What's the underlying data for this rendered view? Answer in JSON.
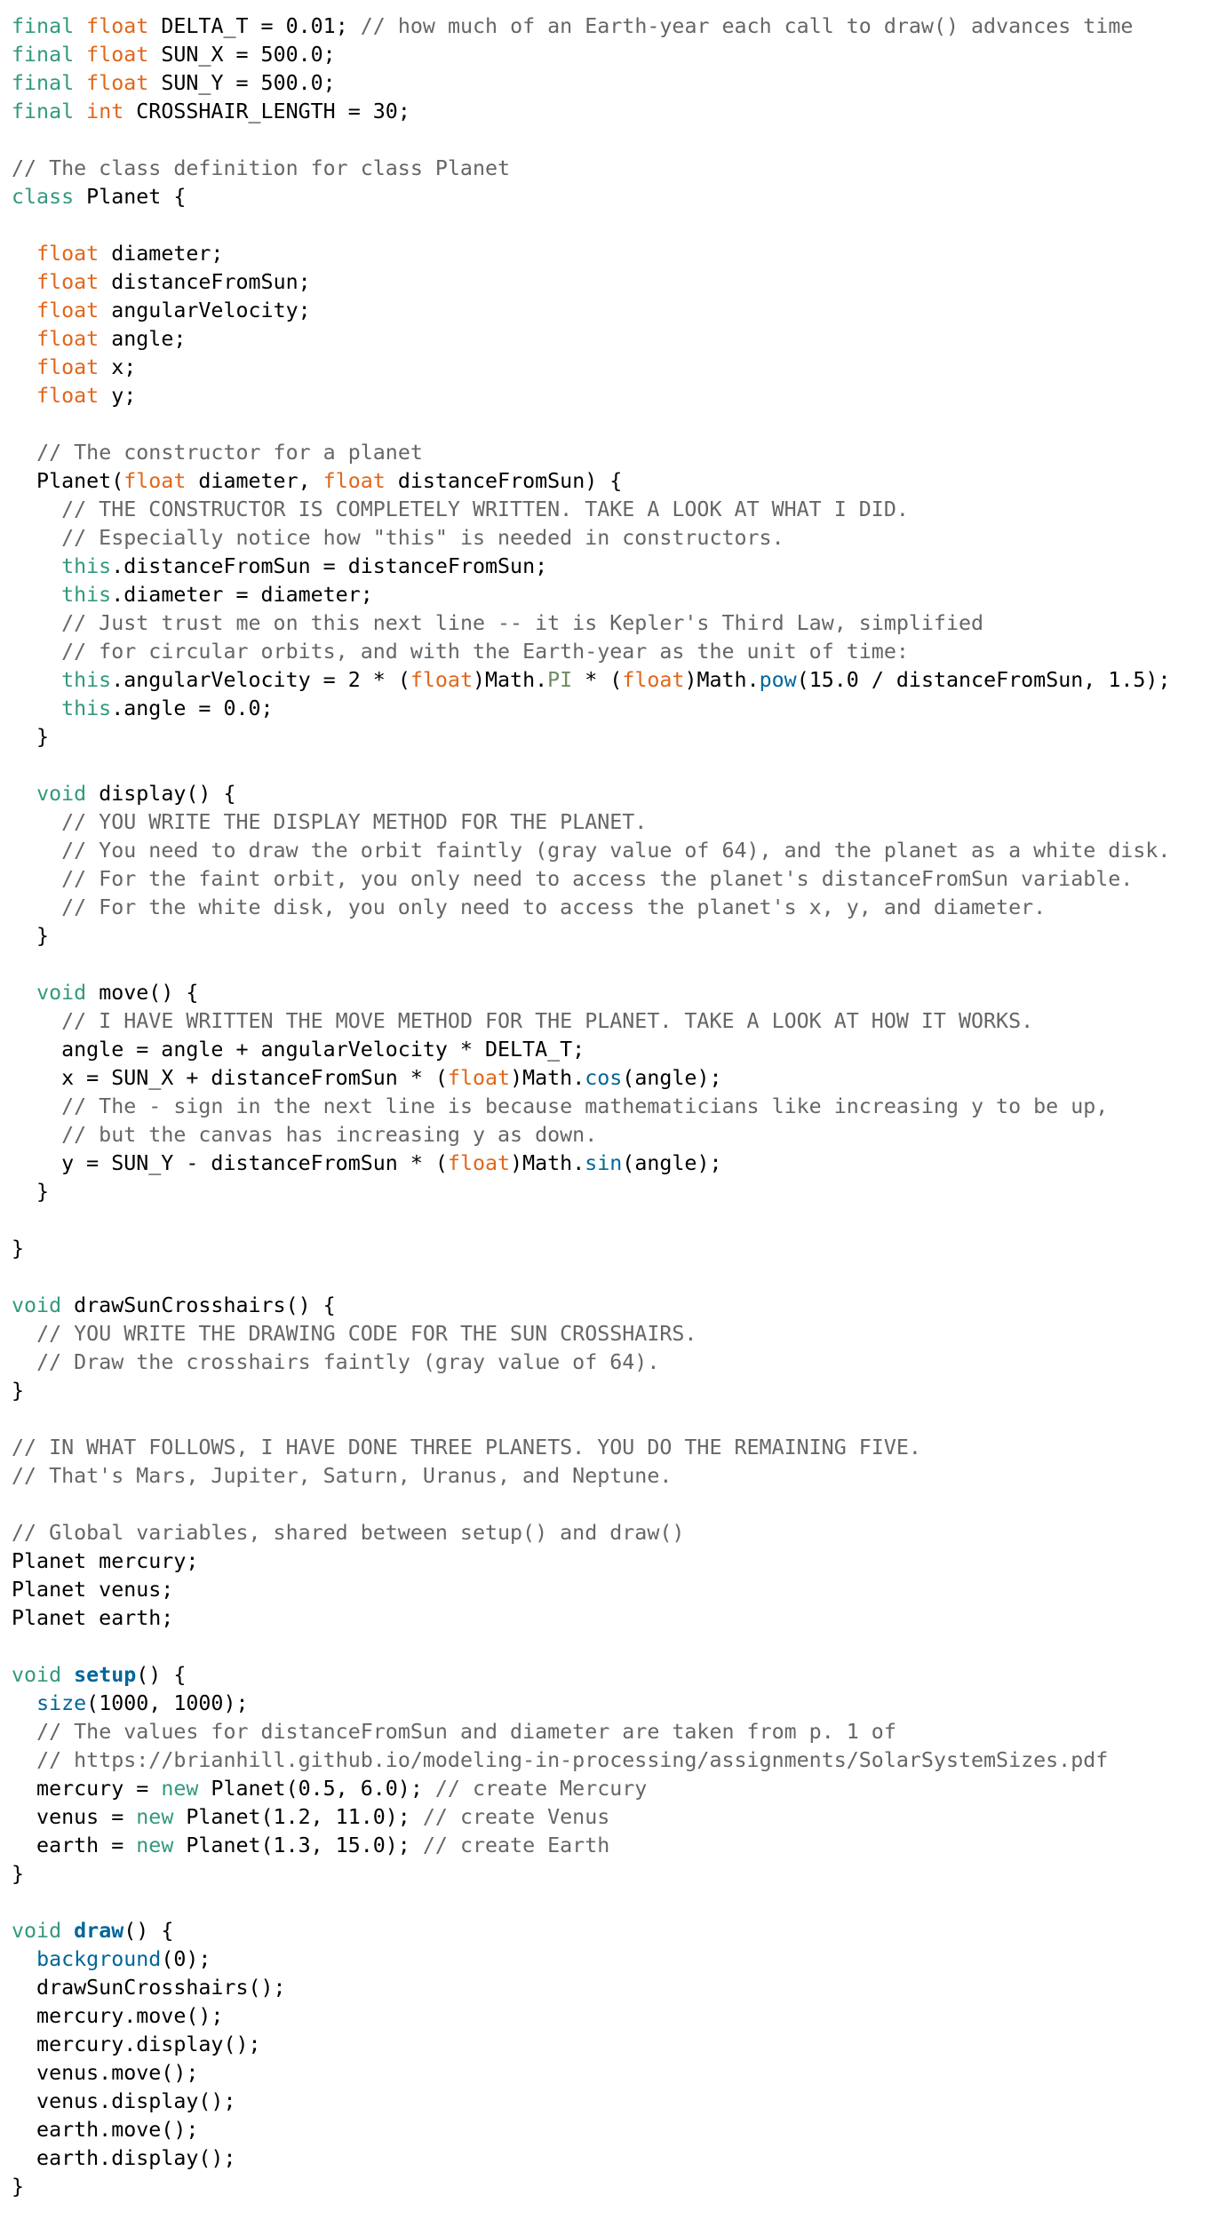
{
  "document": {
    "language": "Processing",
    "colors": {
      "plain": "#000000",
      "kw1": "#33997e",
      "type": "#e2661a",
      "comment": "#666666",
      "fn": "#006699",
      "fnbold": "#006699",
      "const": "#718a62"
    },
    "lines": [
      [
        [
          "kw1",
          "final"
        ],
        [
          "plain",
          " "
        ],
        [
          "type",
          "float"
        ],
        [
          "plain",
          " DELTA_T = 0.01; "
        ],
        [
          "comment",
          "// how much of an Earth-year each call to draw() advances time"
        ]
      ],
      [
        [
          "kw1",
          "final"
        ],
        [
          "plain",
          " "
        ],
        [
          "type",
          "float"
        ],
        [
          "plain",
          " SUN_X = 500.0;"
        ]
      ],
      [
        [
          "kw1",
          "final"
        ],
        [
          "plain",
          " "
        ],
        [
          "type",
          "float"
        ],
        [
          "plain",
          " SUN_Y = 500.0;"
        ]
      ],
      [
        [
          "kw1",
          "final"
        ],
        [
          "plain",
          " "
        ],
        [
          "type",
          "int"
        ],
        [
          "plain",
          " CROSSHAIR_LENGTH = 30;"
        ]
      ],
      [],
      [
        [
          "comment",
          "// The class definition for class Planet"
        ]
      ],
      [
        [
          "kw1",
          "class"
        ],
        [
          "plain",
          " Planet {"
        ]
      ],
      [],
      [
        [
          "plain",
          "  "
        ],
        [
          "type",
          "float"
        ],
        [
          "plain",
          " diameter;"
        ]
      ],
      [
        [
          "plain",
          "  "
        ],
        [
          "type",
          "float"
        ],
        [
          "plain",
          " distanceFromSun;"
        ]
      ],
      [
        [
          "plain",
          "  "
        ],
        [
          "type",
          "float"
        ],
        [
          "plain",
          " angularVelocity;"
        ]
      ],
      [
        [
          "plain",
          "  "
        ],
        [
          "type",
          "float"
        ],
        [
          "plain",
          " angle;"
        ]
      ],
      [
        [
          "plain",
          "  "
        ],
        [
          "type",
          "float"
        ],
        [
          "plain",
          " x;"
        ]
      ],
      [
        [
          "plain",
          "  "
        ],
        [
          "type",
          "float"
        ],
        [
          "plain",
          " y;"
        ]
      ],
      [],
      [
        [
          "plain",
          "  "
        ],
        [
          "comment",
          "// The constructor for a planet"
        ]
      ],
      [
        [
          "plain",
          "  Planet("
        ],
        [
          "type",
          "float"
        ],
        [
          "plain",
          " diameter, "
        ],
        [
          "type",
          "float"
        ],
        [
          "plain",
          " distanceFromSun) {"
        ]
      ],
      [
        [
          "plain",
          "    "
        ],
        [
          "comment",
          "// THE CONSTRUCTOR IS COMPLETELY WRITTEN. TAKE A LOOK AT WHAT I DID."
        ]
      ],
      [
        [
          "plain",
          "    "
        ],
        [
          "comment",
          "// Especially notice how \"this\" is needed in constructors."
        ]
      ],
      [
        [
          "plain",
          "    "
        ],
        [
          "kw1",
          "this"
        ],
        [
          "plain",
          ".distanceFromSun = distanceFromSun;"
        ]
      ],
      [
        [
          "plain",
          "    "
        ],
        [
          "kw1",
          "this"
        ],
        [
          "plain",
          ".diameter = diameter;"
        ]
      ],
      [
        [
          "plain",
          "    "
        ],
        [
          "comment",
          "// Just trust me on this next line -- it is Kepler's Third Law, simplified"
        ]
      ],
      [
        [
          "plain",
          "    "
        ],
        [
          "comment",
          "// for circular orbits, and with the Earth-year as the unit of time:"
        ]
      ],
      [
        [
          "plain",
          "    "
        ],
        [
          "kw1",
          "this"
        ],
        [
          "plain",
          ".angularVelocity = 2 * ("
        ],
        [
          "type",
          "float"
        ],
        [
          "plain",
          ")Math."
        ],
        [
          "const",
          "PI"
        ],
        [
          "plain",
          " * ("
        ],
        [
          "type",
          "float"
        ],
        [
          "plain",
          ")Math."
        ],
        [
          "fn",
          "pow"
        ],
        [
          "plain",
          "(15.0 / distanceFromSun, 1.5);"
        ]
      ],
      [
        [
          "plain",
          "    "
        ],
        [
          "kw1",
          "this"
        ],
        [
          "plain",
          ".angle = 0.0;"
        ]
      ],
      [
        [
          "plain",
          "  }"
        ]
      ],
      [],
      [
        [
          "plain",
          "  "
        ],
        [
          "kw1",
          "void"
        ],
        [
          "plain",
          " display() {"
        ]
      ],
      [
        [
          "plain",
          "    "
        ],
        [
          "comment",
          "// YOU WRITE THE DISPLAY METHOD FOR THE PLANET."
        ]
      ],
      [
        [
          "plain",
          "    "
        ],
        [
          "comment",
          "// You need to draw the orbit faintly (gray value of 64), and the planet as a white disk."
        ]
      ],
      [
        [
          "plain",
          "    "
        ],
        [
          "comment",
          "// For the faint orbit, you only need to access the planet's distanceFromSun variable."
        ]
      ],
      [
        [
          "plain",
          "    "
        ],
        [
          "comment",
          "// For the white disk, you only need to access the planet's x, y, and diameter."
        ]
      ],
      [
        [
          "plain",
          "  }"
        ]
      ],
      [],
      [
        [
          "plain",
          "  "
        ],
        [
          "kw1",
          "void"
        ],
        [
          "plain",
          " move() {"
        ]
      ],
      [
        [
          "plain",
          "    "
        ],
        [
          "comment",
          "// I HAVE WRITTEN THE MOVE METHOD FOR THE PLANET. TAKE A LOOK AT HOW IT WORKS."
        ]
      ],
      [
        [
          "plain",
          "    angle = angle + angularVelocity * DELTA_T;"
        ]
      ],
      [
        [
          "plain",
          "    x = SUN_X + distanceFromSun * ("
        ],
        [
          "type",
          "float"
        ],
        [
          "plain",
          ")Math."
        ],
        [
          "fn",
          "cos"
        ],
        [
          "plain",
          "(angle);"
        ]
      ],
      [
        [
          "plain",
          "    "
        ],
        [
          "comment",
          "// The - sign in the next line is because mathematicians like increasing y to be up,"
        ]
      ],
      [
        [
          "plain",
          "    "
        ],
        [
          "comment",
          "// but the canvas has increasing y as down."
        ]
      ],
      [
        [
          "plain",
          "    y = SUN_Y - distanceFromSun * ("
        ],
        [
          "type",
          "float"
        ],
        [
          "plain",
          ")Math."
        ],
        [
          "fn",
          "sin"
        ],
        [
          "plain",
          "(angle);"
        ]
      ],
      [
        [
          "plain",
          "  }"
        ]
      ],
      [],
      [
        [
          "plain",
          "}"
        ]
      ],
      [],
      [
        [
          "kw1",
          "void"
        ],
        [
          "plain",
          " drawSunCrosshairs() {"
        ]
      ],
      [
        [
          "plain",
          "  "
        ],
        [
          "comment",
          "// YOU WRITE THE DRAWING CODE FOR THE SUN CROSSHAIRS."
        ]
      ],
      [
        [
          "plain",
          "  "
        ],
        [
          "comment",
          "// Draw the crosshairs faintly (gray value of 64)."
        ]
      ],
      [
        [
          "plain",
          "}"
        ]
      ],
      [],
      [
        [
          "comment",
          "// IN WHAT FOLLOWS, I HAVE DONE THREE PLANETS. YOU DO THE REMAINING FIVE."
        ]
      ],
      [
        [
          "comment",
          "// That's Mars, Jupiter, Saturn, Uranus, and Neptune."
        ]
      ],
      [],
      [
        [
          "comment",
          "// Global variables, shared between setup() and draw()"
        ]
      ],
      [
        [
          "plain",
          "Planet mercury;"
        ]
      ],
      [
        [
          "plain",
          "Planet venus;"
        ]
      ],
      [
        [
          "plain",
          "Planet earth;"
        ]
      ],
      [],
      [
        [
          "kw1",
          "void"
        ],
        [
          "plain",
          " "
        ],
        [
          "fnbold",
          "setup"
        ],
        [
          "plain",
          "() {"
        ]
      ],
      [
        [
          "plain",
          "  "
        ],
        [
          "fn",
          "size"
        ],
        [
          "plain",
          "(1000, 1000);"
        ]
      ],
      [
        [
          "plain",
          "  "
        ],
        [
          "comment",
          "// The values for distanceFromSun and diameter are taken from p. 1 of"
        ]
      ],
      [
        [
          "plain",
          "  "
        ],
        [
          "comment",
          "// https://brianhill.github.io/modeling-in-processing/assignments/SolarSystemSizes.pdf"
        ]
      ],
      [
        [
          "plain",
          "  mercury = "
        ],
        [
          "kw1",
          "new"
        ],
        [
          "plain",
          " Planet(0.5, 6.0); "
        ],
        [
          "comment",
          "// create Mercury"
        ]
      ],
      [
        [
          "plain",
          "  venus = "
        ],
        [
          "kw1",
          "new"
        ],
        [
          "plain",
          " Planet(1.2, 11.0); "
        ],
        [
          "comment",
          "// create Venus"
        ]
      ],
      [
        [
          "plain",
          "  earth = "
        ],
        [
          "kw1",
          "new"
        ],
        [
          "plain",
          " Planet(1.3, 15.0); "
        ],
        [
          "comment",
          "// create Earth"
        ]
      ],
      [
        [
          "plain",
          "}"
        ]
      ],
      [],
      [
        [
          "kw1",
          "void"
        ],
        [
          "plain",
          " "
        ],
        [
          "fnbold",
          "draw"
        ],
        [
          "plain",
          "() {"
        ]
      ],
      [
        [
          "plain",
          "  "
        ],
        [
          "fn",
          "background"
        ],
        [
          "plain",
          "(0);"
        ]
      ],
      [
        [
          "plain",
          "  drawSunCrosshairs();"
        ]
      ],
      [
        [
          "plain",
          "  mercury.move();"
        ]
      ],
      [
        [
          "plain",
          "  mercury.display();"
        ]
      ],
      [
        [
          "plain",
          "  venus.move();"
        ]
      ],
      [
        [
          "plain",
          "  venus.display();"
        ]
      ],
      [
        [
          "plain",
          "  earth.move();"
        ]
      ],
      [
        [
          "plain",
          "  earth.display();"
        ]
      ],
      [
        [
          "plain",
          "}"
        ]
      ]
    ]
  }
}
